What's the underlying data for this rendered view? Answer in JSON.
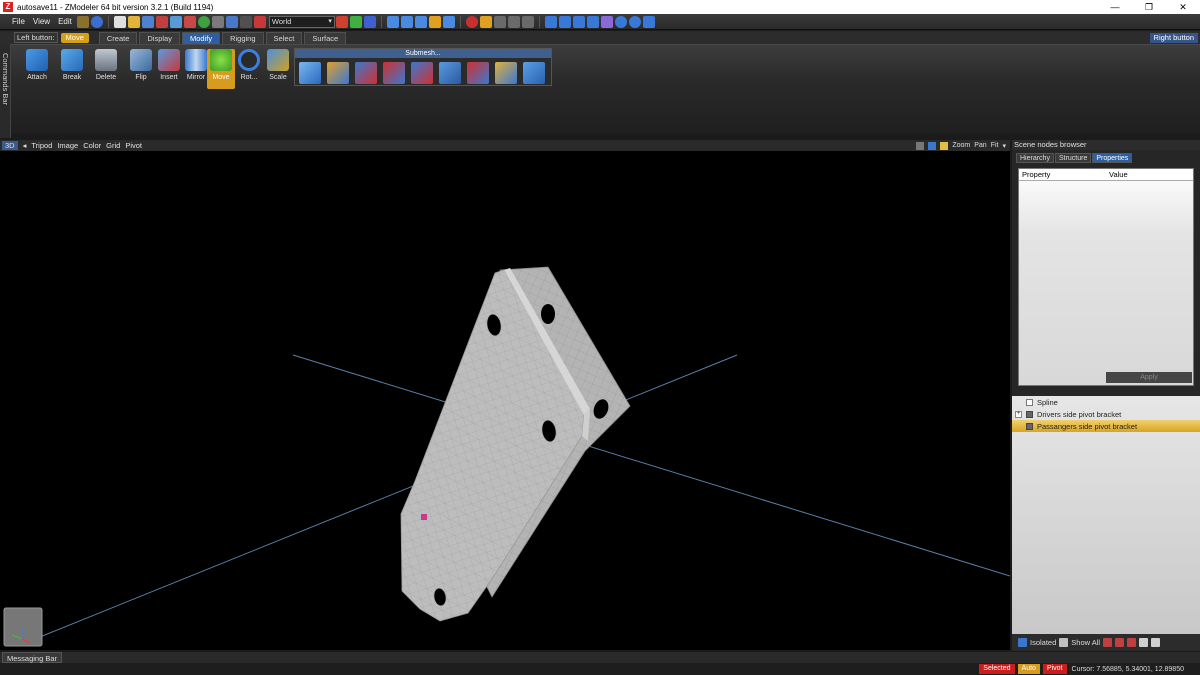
{
  "window": {
    "title": "autosave11 - ZModeler 64 bit version 3.2.1 (Build 1194)",
    "app_icon": "Z",
    "controls": [
      "—",
      "❐",
      "✕"
    ]
  },
  "menu": [
    "File",
    "View",
    "Edit"
  ],
  "toolbar": {
    "coordinate_space": "World"
  },
  "mode_row": {
    "left_button_label": "Left button:",
    "left_button_value": "Move",
    "tabs": [
      "Create",
      "Display",
      "Modify",
      "Rigging",
      "Select",
      "Surface"
    ],
    "active_tab": "Modify",
    "right_button_label": "Right button"
  },
  "commands_bar_label": "Commands Bar",
  "ribbon": {
    "buttons": [
      "Attach",
      "Break",
      "Delete",
      "Flip",
      "Insert",
      "Mirror",
      "Move",
      "Rot...",
      "Scale"
    ],
    "active": "Move",
    "submesh_label": "Submesh..."
  },
  "viewport_header": {
    "view": "3D",
    "items": [
      "Tripod",
      "Image",
      "Color",
      "Grid",
      "Pivot"
    ],
    "right": [
      "Zoom",
      "Pan",
      "Fit"
    ]
  },
  "scene_browser": {
    "title": "Scene nodes browser",
    "tabs": [
      "Hierarchy",
      "Structure",
      "Properties"
    ],
    "active_tab": "Properties",
    "columns": [
      "Property",
      "Value"
    ],
    "apply_label": "Apply",
    "nodes": [
      {
        "name": "Spline",
        "selected": false
      },
      {
        "name": "Drivers side pivot bracket",
        "selected": false
      },
      {
        "name": "Passangers side pivot bracket",
        "selected": true
      }
    ],
    "tools": [
      "Isolated",
      "Show All"
    ]
  },
  "messaging_bar_label": "Messaging Bar",
  "status": {
    "selected": "Selected",
    "auto": "Auto",
    "pivot": "Pivot",
    "cursor": "Cursor: 7.56885, 5.34001, 12.89850"
  },
  "colors": {
    "accent_blue": "#2f5f9f",
    "active_gold": "#d79c1d",
    "status_red": "#c81e1e"
  }
}
